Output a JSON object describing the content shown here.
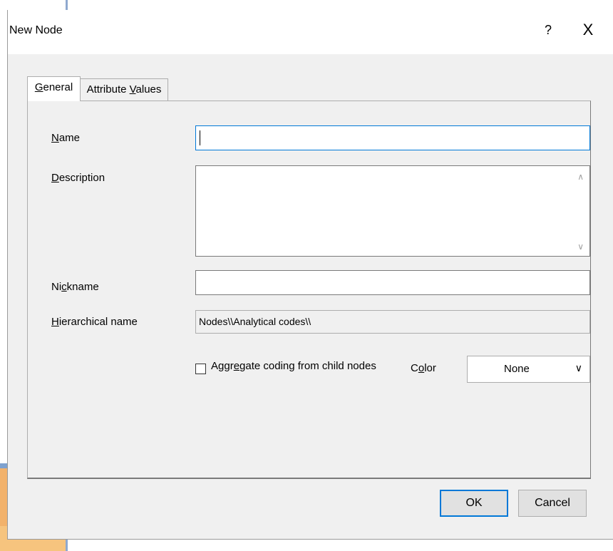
{
  "window": {
    "title": "New Node",
    "help_label": "?",
    "close_label": "X"
  },
  "tabs": [
    {
      "label_pre": "",
      "label_key": "G",
      "label_post": "eneral",
      "active": true
    },
    {
      "label_pre": "Attribute ",
      "label_key": "V",
      "label_post": "alues",
      "active": false
    }
  ],
  "form": {
    "name": {
      "label_pre": "",
      "label_key": "N",
      "label_post": "ame",
      "value": ""
    },
    "description": {
      "label_pre": "",
      "label_key": "D",
      "label_post": "escription",
      "value": ""
    },
    "nickname": {
      "label_pre": "Ni",
      "label_key": "c",
      "label_post": "kname",
      "value": ""
    },
    "hierarchical_name": {
      "label_pre": "",
      "label_key": "H",
      "label_post": "ierarchical name",
      "value": "Nodes\\\\Analytical codes\\\\"
    },
    "aggregate": {
      "label_pre": "Aggr",
      "label_key": "e",
      "label_post": "gate coding from child nodes",
      "checked": false
    },
    "color": {
      "label_pre": "C",
      "label_key": "o",
      "label_post": "lor",
      "value": "None"
    }
  },
  "buttons": {
    "ok": "OK",
    "cancel": "Cancel"
  },
  "icons": {
    "scroll_up": "chevron-up-icon",
    "scroll_down": "chevron-down-icon",
    "dropdown": "chevron-down-icon"
  }
}
